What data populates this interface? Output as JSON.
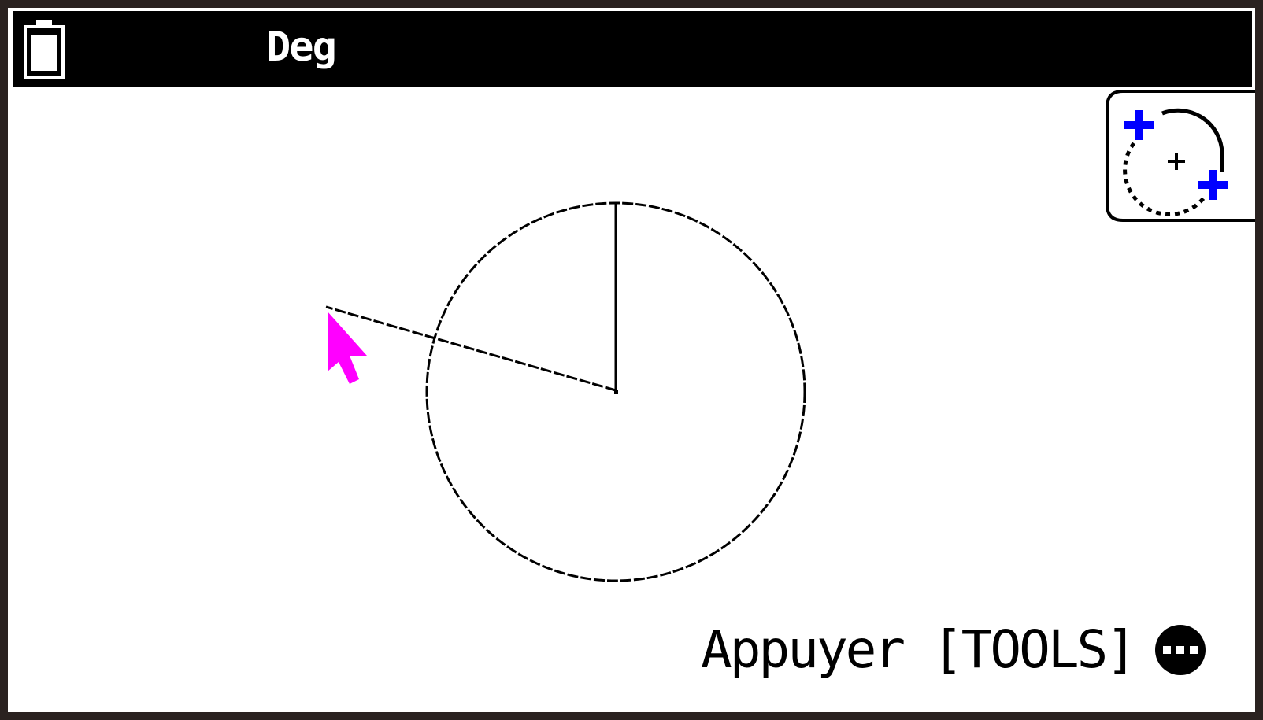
{
  "status_bar": {
    "angle_mode": "Deg",
    "battery_icon": "battery-icon"
  },
  "tool_button": {
    "icon": "circle-plus-icon",
    "accent_color": "#0000ff"
  },
  "drawing": {
    "shape": "circle",
    "pointer_color": "#ff00ff"
  },
  "hint": {
    "text": "Appuyer [TOOLS]",
    "icon": "more-dots-icon"
  }
}
